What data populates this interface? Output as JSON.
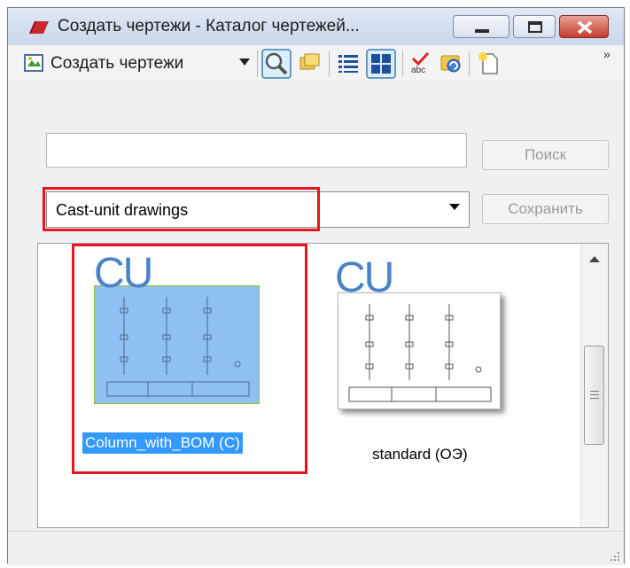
{
  "window": {
    "title": "Создать чертежи - Каталог чертежей..."
  },
  "toolbar": {
    "create_label": "Создать чертежи",
    "more_glyph": "»",
    "icons": [
      "create-drawings-icon",
      "dropdown-arrow-icon",
      "search-icon",
      "open-folder-icon",
      "list-view-icon",
      "thumbnail-view-icon",
      "spell-check-icon",
      "refresh-icon",
      "new-icon"
    ]
  },
  "search": {
    "value": "",
    "placeholder": "",
    "button_label": "Поиск"
  },
  "filter": {
    "selected": "Cast-unit drawings",
    "save_label": "Сохранить"
  },
  "catalog": {
    "items": [
      {
        "badge": "CU",
        "label": "Column_with_BOM (C)",
        "selected": true
      },
      {
        "badge": "CU",
        "label": "standard (ОЭ)",
        "selected": false
      }
    ]
  },
  "colors": {
    "highlight": "#e8141e",
    "selection": "#3399ff",
    "cu_text": "#4a82c8"
  }
}
